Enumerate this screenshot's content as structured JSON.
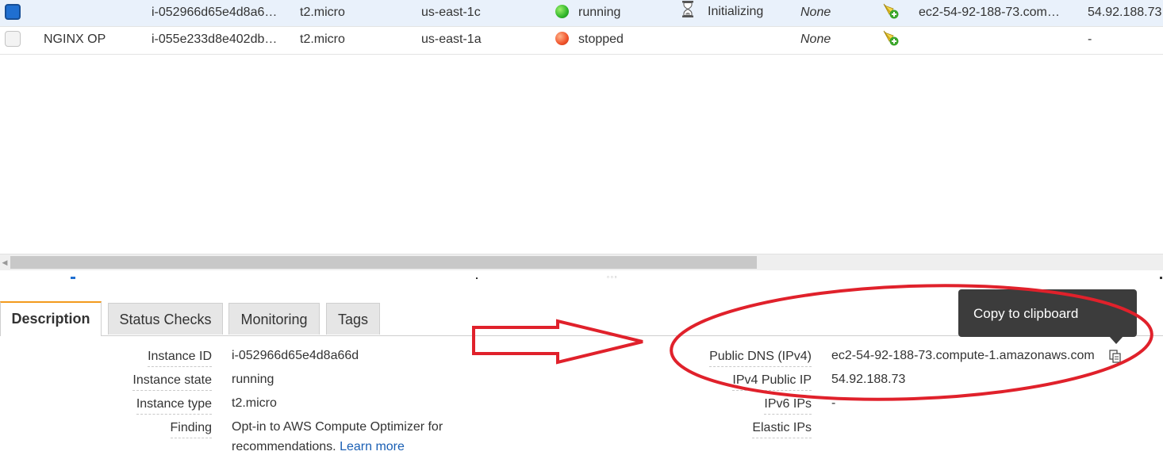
{
  "instances": [
    {
      "selected": true,
      "name": "",
      "instance_id": "i-052966d65e4d8a6…",
      "instance_type": "t2.micro",
      "availability_zone": "us-east-1c",
      "state": "running",
      "status_checks": "Initializing",
      "alarm_status": "None",
      "public_dns": "ec2-54-92-188-73.com…",
      "public_ip": "54.92.188.73"
    },
    {
      "selected": false,
      "name": "NGINX OP",
      "instance_id": "i-055e233d8e402db…",
      "instance_type": "t2.micro",
      "availability_zone": "us-east-1a",
      "state": "stopped",
      "status_checks": "",
      "alarm_status": "None",
      "public_dns": "",
      "public_ip": "-"
    }
  ],
  "tabs": [
    "Description",
    "Status Checks",
    "Monitoring",
    "Tags"
  ],
  "description": {
    "instance_id_label": "Instance ID",
    "instance_id": "i-052966d65e4d8a66d",
    "instance_state_label": "Instance state",
    "instance_state": "running",
    "instance_type_label": "Instance type",
    "instance_type": "t2.micro",
    "finding_label": "Finding",
    "finding_line1": "Opt-in to AWS Compute Optimizer for",
    "finding_line2": "recommendations.",
    "learn_more": "Learn more",
    "public_dns_label": "Public DNS (IPv4)",
    "public_dns": "ec2-54-92-188-73.compute-1.amazonaws.com",
    "public_ip_label": "IPv4 Public IP",
    "public_ip": "54.92.188.73",
    "ipv6_label": "IPv6 IPs",
    "ipv6": "-",
    "elastic_label": "Elastic IPs"
  },
  "tooltip": "Copy to clipboard",
  "colors": {
    "selected_row": "#e9f1fb",
    "active_tab_accent": "#f29a1e",
    "running": "#2fb52a",
    "stopped": "#f0522a",
    "annotation": "#e0212b",
    "link": "#1a5fb4"
  },
  "icons": [
    "hourglass-icon",
    "alarm-add-icon",
    "copy-icon",
    "running-status-icon",
    "stopped-status-icon"
  ]
}
